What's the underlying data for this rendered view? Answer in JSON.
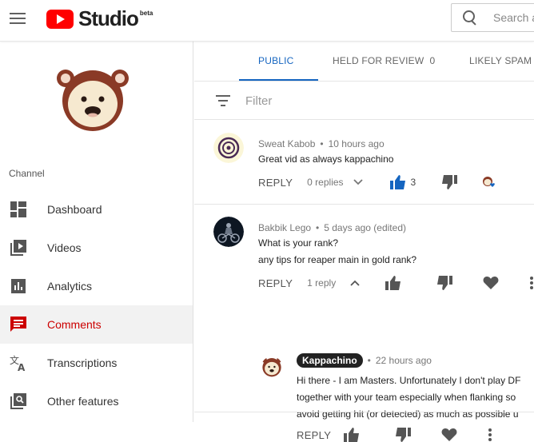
{
  "header": {
    "logo_text": "Studio",
    "beta_label": "beta",
    "search_placeholder": "Search a"
  },
  "sidebar": {
    "channel_label": "Channel",
    "items": [
      {
        "label": "Dashboard",
        "icon": "dashboard-icon"
      },
      {
        "label": "Videos",
        "icon": "videos-icon"
      },
      {
        "label": "Analytics",
        "icon": "analytics-icon"
      },
      {
        "label": "Comments",
        "icon": "comments-icon",
        "active": true
      },
      {
        "label": "Transcriptions",
        "icon": "translate-icon"
      },
      {
        "label": "Other features",
        "icon": "other-features-icon"
      }
    ]
  },
  "tabs": [
    {
      "label": "PUBLIC",
      "active": true
    },
    {
      "label": "HELD FOR REVIEW",
      "count": "0"
    },
    {
      "label": "LIKELY SPAM"
    }
  ],
  "filter": {
    "placeholder": "Filter"
  },
  "comments": [
    {
      "author": "Sweat Kabob",
      "time": "10 hours ago",
      "text": "Great vid as always kappachino",
      "reply_label": "REPLY",
      "replies_label": "0 replies",
      "likes": "3"
    },
    {
      "author": "Bakbik Lego",
      "time": "5 days ago (edited)",
      "lines": [
        "What is your rank?",
        "any tips for reaper main in gold rank?"
      ],
      "reply_label": "REPLY",
      "replies_label": "1 reply"
    }
  ],
  "reply": {
    "author": "Kappachino",
    "time": "22 hours ago",
    "lines": [
      "Hi there - I am Masters. Unfortunately I don't play DF",
      "together with your team especially when flanking so",
      "avoid getting hit (or detected) as much as possible u"
    ],
    "reply_label": "REPLY"
  },
  "colors": {
    "accent": "#1565c0",
    "active_nav": "#cc0000",
    "youtube_red": "#ff0000"
  }
}
